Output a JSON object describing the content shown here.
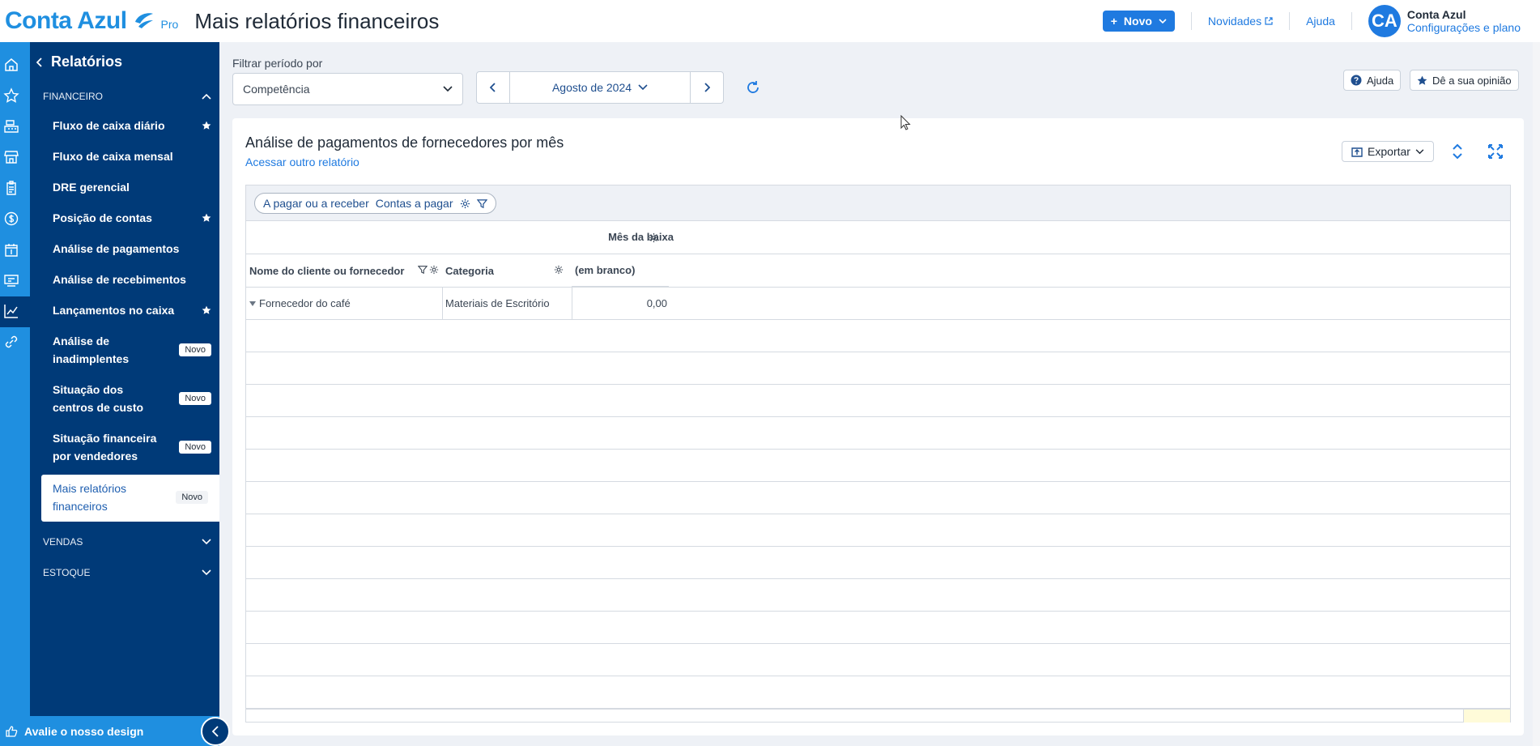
{
  "header": {
    "logo_text": "Conta Azul",
    "logo_badge": "Pro",
    "title": "Mais relatórios financeiros",
    "new_button": "Novo",
    "news_link": "Novidades",
    "help_link": "Ajuda",
    "avatar_initials": "CA",
    "account_name": "Conta Azul",
    "account_sub": "Configurações e plano"
  },
  "rail": {
    "icons": [
      "home-icon",
      "star-icon",
      "cash-register-icon",
      "store-icon",
      "clipboard-icon",
      "dollar-icon",
      "calendar-dollar-icon",
      "receipt-icon",
      "chart-icon",
      "link-icon"
    ]
  },
  "sidebar": {
    "back_label": "Relatórios",
    "sections": {
      "financeiro": "FINANCEIRO",
      "vendas": "VENDAS",
      "estoque": "ESTOQUE"
    },
    "items": [
      {
        "label": "Fluxo de caixa diário",
        "starred": true
      },
      {
        "label": "Fluxo de caixa mensal",
        "starred": false
      },
      {
        "label": "DRE gerencial",
        "starred": false
      },
      {
        "label": "Posição de contas",
        "starred": true
      },
      {
        "label": "Análise de pagamentos",
        "starred": false
      },
      {
        "label": "Análise de recebimentos",
        "starred": false
      },
      {
        "label": "Lançamentos no caixa",
        "starred": true
      },
      {
        "label": "Análise de inadimplentes",
        "badge": "Novo"
      },
      {
        "label": "Situação dos centros de custo",
        "badge": "Novo"
      },
      {
        "label": "Situação financeira por vendedores",
        "badge": "Novo"
      },
      {
        "label": "Mais relatórios financeiros",
        "badge": "Novo",
        "active": true
      }
    ],
    "rate_design": "Avalie o nosso design"
  },
  "filters": {
    "period_label": "Filtrar período por",
    "period_type": "Competência",
    "month": "Agosto de 2024",
    "help_button": "Ajuda",
    "feedback_button": "Dê a sua opinião"
  },
  "report": {
    "title": "Análise de pagamentos de fornecedores por mês",
    "other_report_link": "Acessar outro relatório",
    "export_button": "Exportar",
    "filter_chip": {
      "key": "A pagar ou a receber",
      "value": "Contas a pagar"
    },
    "column_field": "Mês da baixa",
    "row_headers": [
      "Nome do cliente ou fornecedor",
      "Categoria",
      "(em branco)"
    ],
    "rows": [
      {
        "supplier": "Fornecedor do café",
        "category": "Materiais de Escritório",
        "value": "0,00"
      }
    ]
  },
  "colors": {
    "brand_blue": "#1f8fe0",
    "sidebar_navy": "#003a78",
    "accent": "#1f7ae0"
  }
}
